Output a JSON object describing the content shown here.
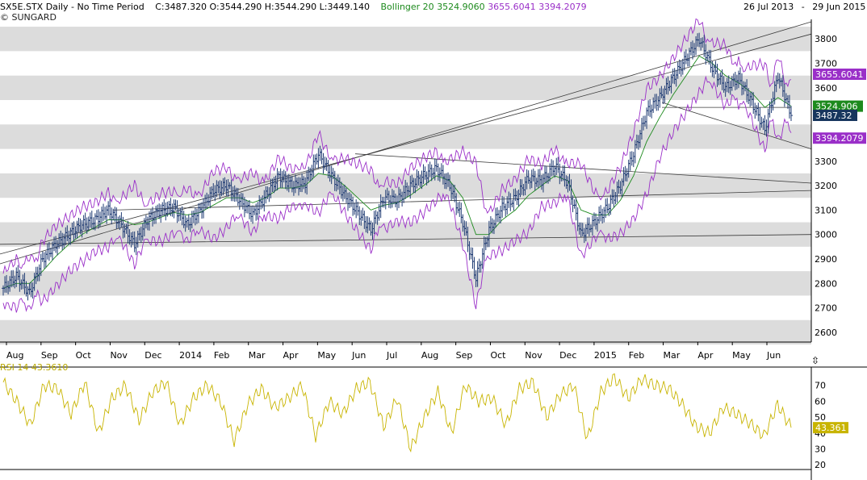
{
  "header": {
    "symbol": "SX5E.STX Daily",
    "separator": "-",
    "period": "No Time Period",
    "ohlc": "C:3487.320 O:3544.290 H:3544.290 L:3449.140",
    "indicator_name": "Bollinger 20",
    "bb_mid": "3524.9060",
    "bb_upper": "3655.6041",
    "bb_lower": "3394.2079",
    "date_from": "26 Jul 2013",
    "date_sep": "-",
    "date_to": "29 Jun 2015"
  },
  "copyright": "© SUNGARD",
  "rsi": {
    "label": "RSI 14",
    "value_label": "43.3610",
    "badge": "43.361"
  },
  "colors": {
    "price": "#1f3b73",
    "sma": "#1d8a1d",
    "bands": "#9a2fc8",
    "rsi": "#c8b400",
    "grid_band": "#dcdcdc",
    "close_badge": "#17365d"
  },
  "chart_data": [
    {
      "type": "ohlc",
      "series": [
        {
          "name": "SX5E.STX Daily",
          "values": [
            2780,
            2830,
            2760,
            2900,
            2960,
            3000,
            3040,
            3060,
            3100,
            3040,
            2960,
            3060,
            3100,
            3110,
            3040,
            3100,
            3180,
            3200,
            3140,
            3080,
            3160,
            3240,
            3200,
            3210,
            3330,
            3240,
            3160,
            3090,
            3020,
            3150,
            3140,
            3200,
            3240,
            3270,
            3200,
            3050,
            2820,
            3020,
            3110,
            3150,
            3230,
            3220,
            3280,
            3210,
            3000,
            3050,
            3110,
            3200,
            3330,
            3500,
            3560,
            3640,
            3720,
            3800,
            3680,
            3600,
            3640,
            3540,
            3430,
            3650,
            3487
          ]
        },
        {
          "name": "Bollinger 20",
          "values": [
            2780,
            2800,
            2800,
            2850,
            2910,
            2960,
            3000,
            3030,
            3060,
            3060,
            3040,
            3050,
            3070,
            3090,
            3080,
            3090,
            3120,
            3150,
            3150,
            3130,
            3150,
            3190,
            3190,
            3200,
            3250,
            3240,
            3200,
            3150,
            3100,
            3120,
            3130,
            3160,
            3200,
            3240,
            3220,
            3150,
            3000,
            3000,
            3060,
            3100,
            3160,
            3200,
            3240,
            3220,
            3100,
            3080,
            3080,
            3140,
            3240,
            3380,
            3480,
            3570,
            3650,
            3730,
            3700,
            3650,
            3620,
            3580,
            3520,
            3560,
            3524.906
          ]
        }
      ],
      "x_labels": [
        "Aug",
        "Sep",
        "Oct",
        "Nov",
        "Dec",
        "2014",
        "Feb",
        "Mar",
        "Apr",
        "May",
        "Jun",
        "Jul",
        "Aug",
        "Sep",
        "Oct",
        "Nov",
        "Dec",
        "2015",
        "Feb",
        "Mar",
        "Apr",
        "May",
        "Jun"
      ],
      "y_ticks": [
        2600,
        2700,
        2800,
        2900,
        3000,
        3100,
        3200,
        3300,
        3400,
        3500,
        3600,
        3700,
        3800
      ],
      "ylim": [
        2560,
        3880
      ],
      "value_labels": [
        {
          "text": "3655.6041",
          "value": 3655.6041,
          "color": "#9a2fc8"
        },
        {
          "text": "3524.906",
          "value": 3524.906,
          "color": "#1d8a1d"
        },
        {
          "text": "3487.32",
          "value": 3487.32,
          "color": "#17365d"
        },
        {
          "text": "3394.2079",
          "value": 3394.2079,
          "color": "#9a2fc8"
        }
      ]
    },
    {
      "type": "line",
      "series": [
        {
          "name": "RSI 14",
          "values": [
            72,
            60,
            45,
            70,
            68,
            52,
            72,
            40,
            62,
            70,
            48,
            66,
            72,
            45,
            62,
            70,
            60,
            35,
            58,
            68,
            56,
            62,
            70,
            38,
            60,
            52,
            68,
            72,
            44,
            62,
            30,
            50,
            66,
            40,
            70,
            60,
            62,
            45,
            68,
            72,
            50,
            64,
            70,
            36,
            66,
            75,
            62,
            74,
            70,
            68,
            58,
            44,
            40,
            56,
            52,
            46,
            38,
            58,
            43.361
          ]
        }
      ],
      "y_ticks": [
        20,
        30,
        40,
        50,
        60,
        70
      ],
      "ylim": [
        17,
        78
      ]
    }
  ]
}
